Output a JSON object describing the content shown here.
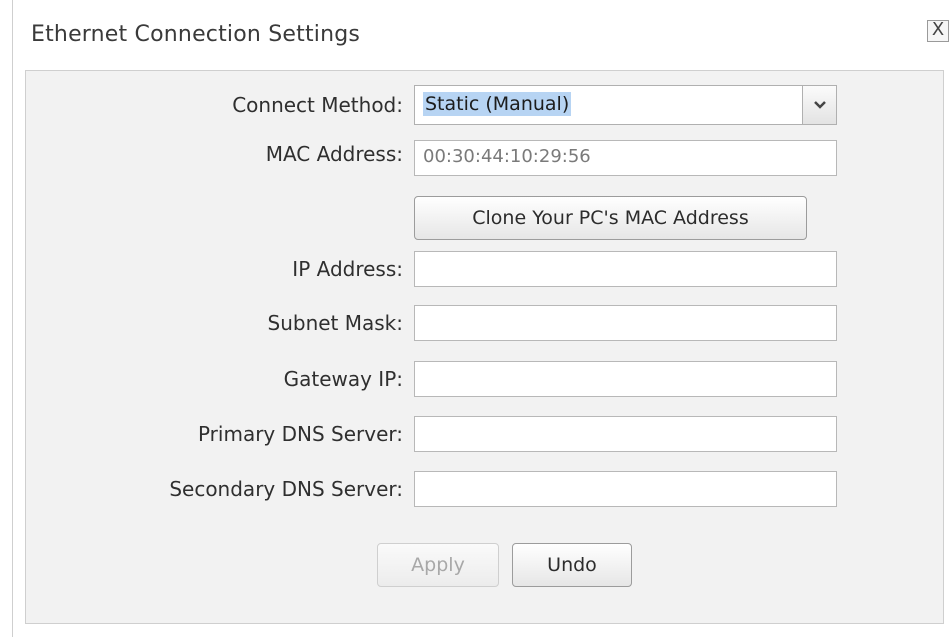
{
  "dialog": {
    "title": "Ethernet Connection Settings",
    "close_label": "X"
  },
  "form": {
    "connect_method": {
      "label": "Connect Method:",
      "value": "Static (Manual)"
    },
    "mac_address": {
      "label": "MAC Address:",
      "value": "00:30:44:10:29:56"
    },
    "clone_button": "Clone Your PC's MAC Address",
    "ip_address": {
      "label": "IP Address:",
      "value": ""
    },
    "subnet_mask": {
      "label": "Subnet Mask:",
      "value": ""
    },
    "gateway_ip": {
      "label": "Gateway IP:",
      "value": ""
    },
    "primary_dns": {
      "label": "Primary DNS Server:",
      "value": ""
    },
    "secondary_dns": {
      "label": "Secondary DNS Server:",
      "value": ""
    }
  },
  "actions": {
    "apply_label": "Apply",
    "undo_label": "Undo"
  },
  "colors": {
    "panel_bg": "#f2f2f2",
    "selection_highlight": "#b7d4f3",
    "disabled_text": "#a8a8a8"
  },
  "icons": {
    "dropdown": "chevron-down-icon",
    "close": "close-icon"
  }
}
